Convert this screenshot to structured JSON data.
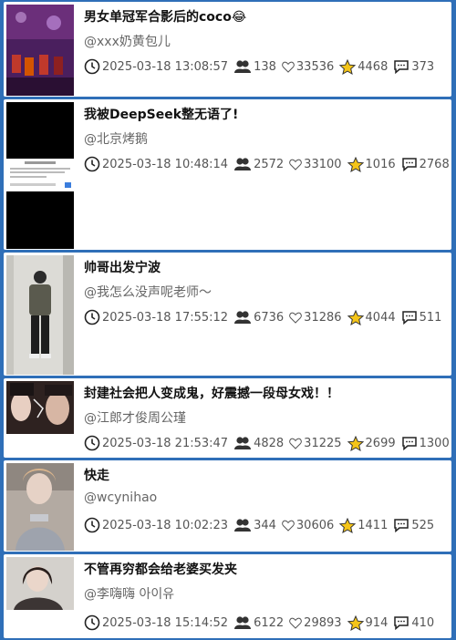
{
  "posts": [
    {
      "title": "男女单冠军合影后的coco😂",
      "author": "@xxx奶黄包儿",
      "time": "2025-03-18 13:08:57",
      "followers": "138",
      "likes": "33536",
      "stars": "4468",
      "comments": "373",
      "thumb_icon": "photo-group-stage-icon"
    },
    {
      "title": "我被DeepSeek整无语了!",
      "author": "@北京烤鹅",
      "time": "2025-03-18 10:48:14",
      "followers": "2572",
      "likes": "33100",
      "stars": "1016",
      "comments": "2768",
      "thumb_icon": "screenshot-icon"
    },
    {
      "title": "帅哥出发宁波",
      "author": "@我怎么没声呢老师～",
      "time": "2025-03-18 17:55:12",
      "followers": "6736",
      "likes": "31286",
      "stars": "4044",
      "comments": "511",
      "thumb_icon": "walking-man-icon"
    },
    {
      "title": "封建社会把人变成鬼，好震撼一段母女戏！！",
      "author": "@江郎才俊周公瑾",
      "time": "2025-03-18 21:53:47",
      "followers": "4828",
      "likes": "31225",
      "stars": "2699",
      "comments": "1300",
      "thumb_icon": "drama-still-icon"
    },
    {
      "title": "快走",
      "author": "@wcynihao",
      "time": "2025-03-18 10:02:23",
      "followers": "344",
      "likes": "30606",
      "stars": "1411",
      "comments": "525",
      "thumb_icon": "portrait-icon"
    },
    {
      "title": "不管再穷都会给老婆买发夹",
      "author": "@李嗨嗨 아이유",
      "time": "2025-03-18 15:14:52",
      "followers": "6122",
      "likes": "29893",
      "stars": "914",
      "comments": "410",
      "thumb_icon": "woman-portrait-icon"
    }
  ],
  "colors": {
    "background": "#2f6fb8",
    "card": "#ffffff",
    "title": "#111111",
    "meta": "#555555",
    "star": "#f5c518"
  }
}
